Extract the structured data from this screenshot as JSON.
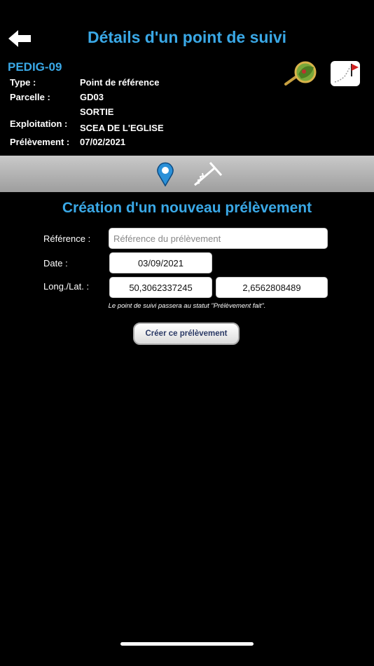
{
  "header": {
    "title": "Détails d'un point de suivi",
    "back_icon": "arrow-left-icon"
  },
  "point": {
    "code": "PEDIG-09",
    "fields": [
      {
        "label": "Type :",
        "value": "Point de référence"
      },
      {
        "label": "Parcelle :",
        "value": "GD03"
      },
      {
        "label": "",
        "value": "SORTIE"
      },
      {
        "label": "Exploitation :",
        "value": "SCEA DE L'EGLISE"
      },
      {
        "label": "Prélèvement :",
        "value": "07/02/2021"
      }
    ]
  },
  "toolbar": {
    "icons": [
      "map-pin-icon",
      "auger-icon"
    ]
  },
  "form": {
    "title": "Création d'un nouveau prélèvement",
    "reference_label": "Référence :",
    "reference_placeholder": "Référence du prélèvement",
    "reference_value": "",
    "date_label": "Date :",
    "date_value": "03/09/2021",
    "coords_label": "Long./Lat. :",
    "longitude": "50,3062337245",
    "latitude": "2,6562808489",
    "note": "Le point de suivi passera au statut \"Prélèvement fait\".",
    "submit_label": "Créer ce prélèvement"
  },
  "colors": {
    "accent": "#3aa8e6",
    "toolbar": "#b5b5b5",
    "background": "#000000"
  }
}
